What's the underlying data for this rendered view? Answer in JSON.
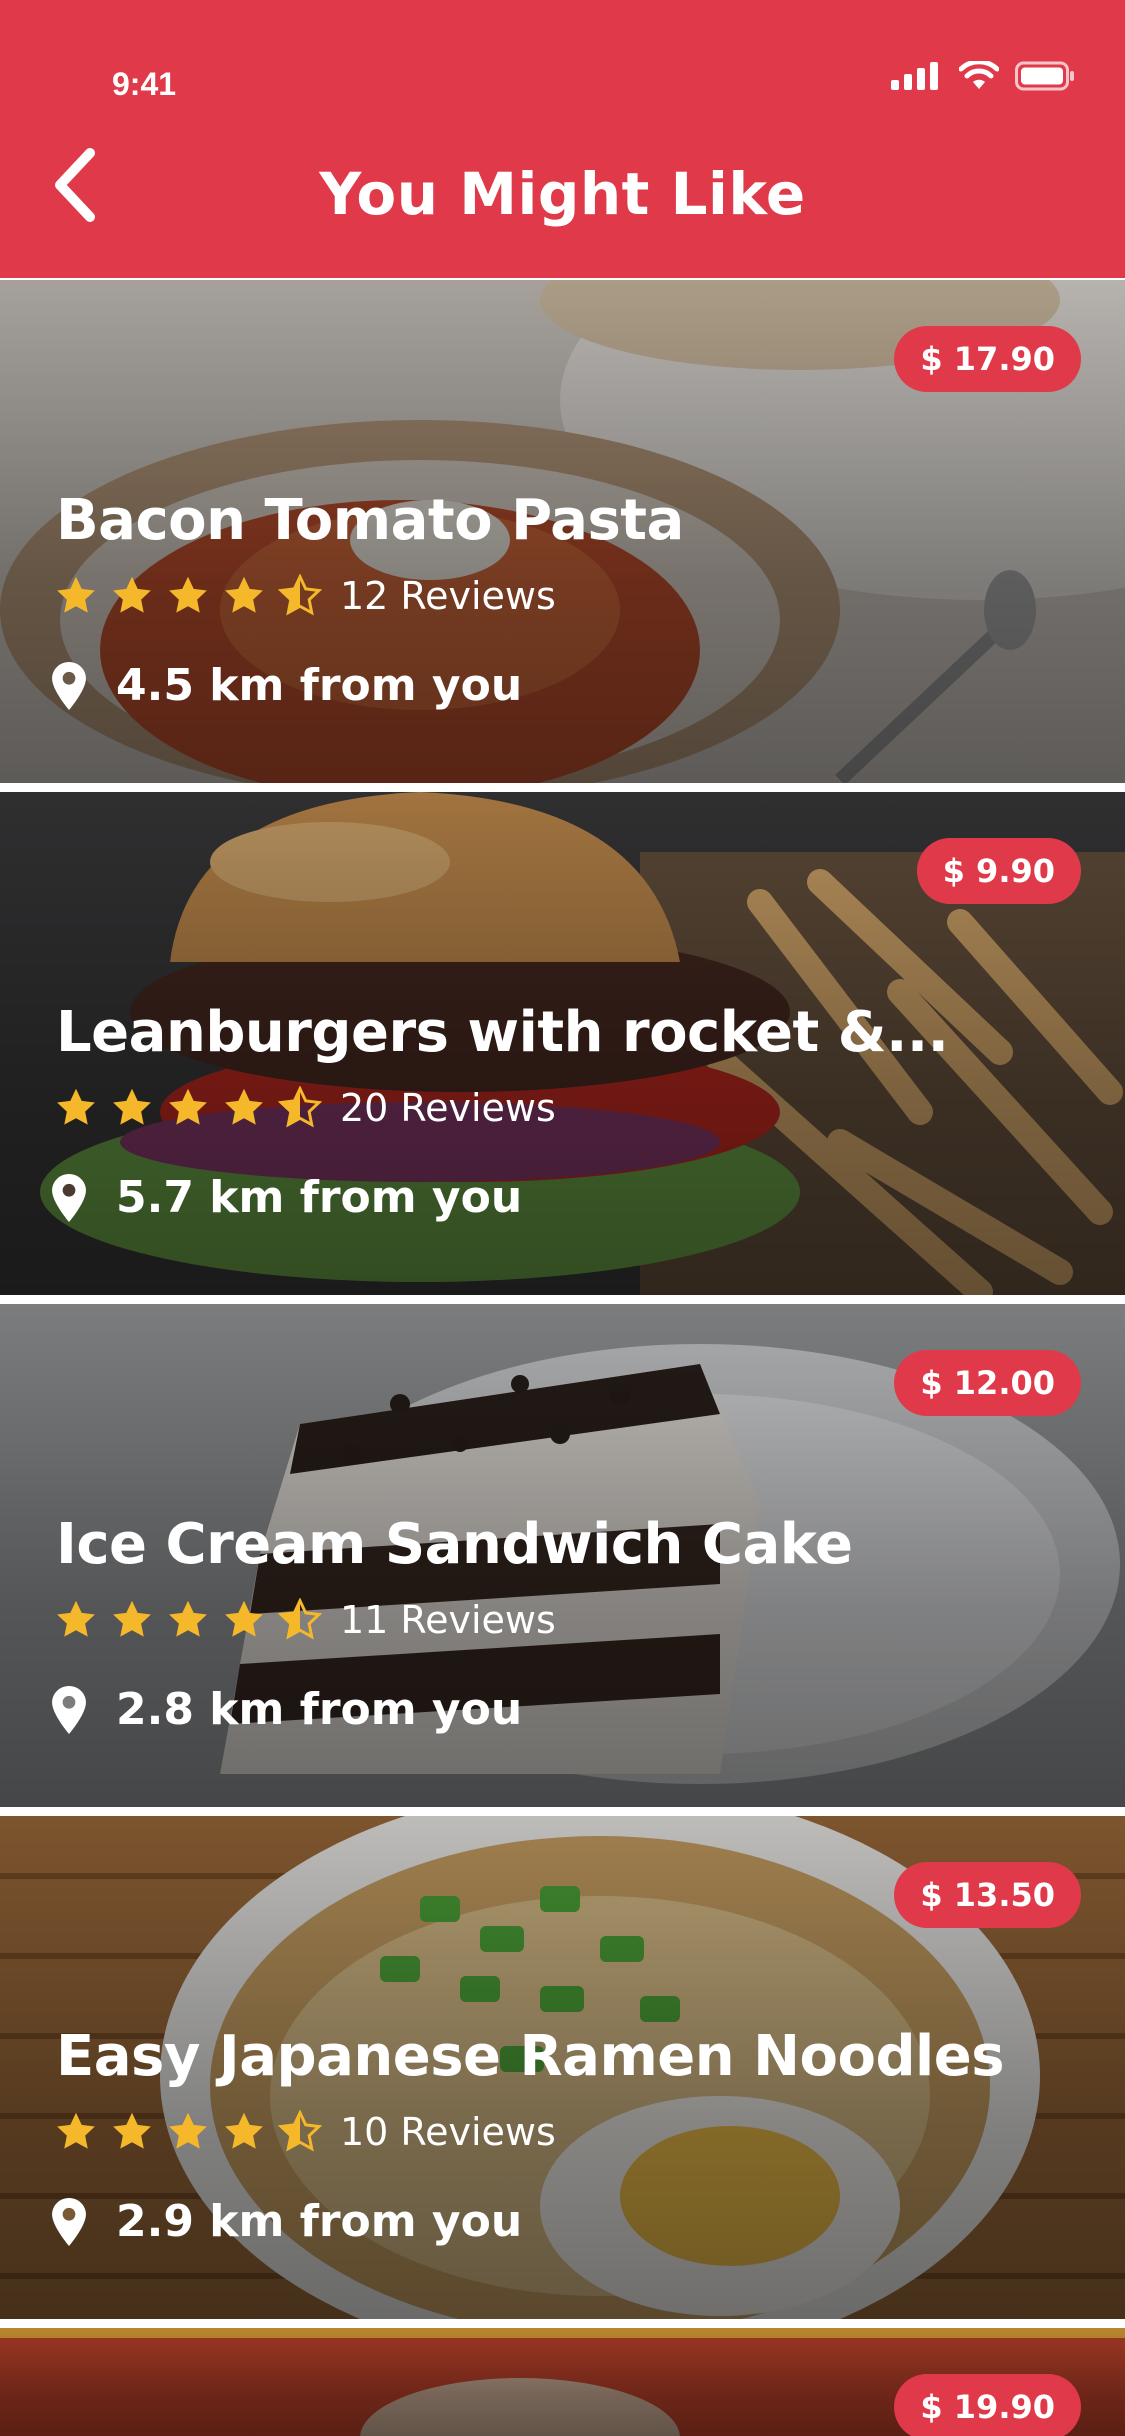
{
  "status_bar": {
    "time": "9:41"
  },
  "header": {
    "title": "You Might Like"
  },
  "colors": {
    "accent": "#e03a4a",
    "star": "#f5b82a"
  },
  "items": [
    {
      "name": "Bacon Tomato Pasta",
      "price": "$ 17.90",
      "rating": 4.5,
      "reviews": "12 Reviews",
      "distance": "4.5 km from you"
    },
    {
      "name": "Leanburgers with rocket &...",
      "price": "$ 9.90",
      "rating": 4.5,
      "reviews": "20 Reviews",
      "distance": "5.7 km from you"
    },
    {
      "name": "Ice Cream Sandwich Cake",
      "price": "$ 12.00",
      "rating": 4.5,
      "reviews": "11 Reviews",
      "distance": "2.8 km from you"
    },
    {
      "name": "Easy Japanese Ramen Noodles",
      "price": "$ 13.50",
      "rating": 4.5,
      "reviews": "10 Reviews",
      "distance": "2.9 km from you"
    },
    {
      "price": "$ 19.90"
    }
  ]
}
